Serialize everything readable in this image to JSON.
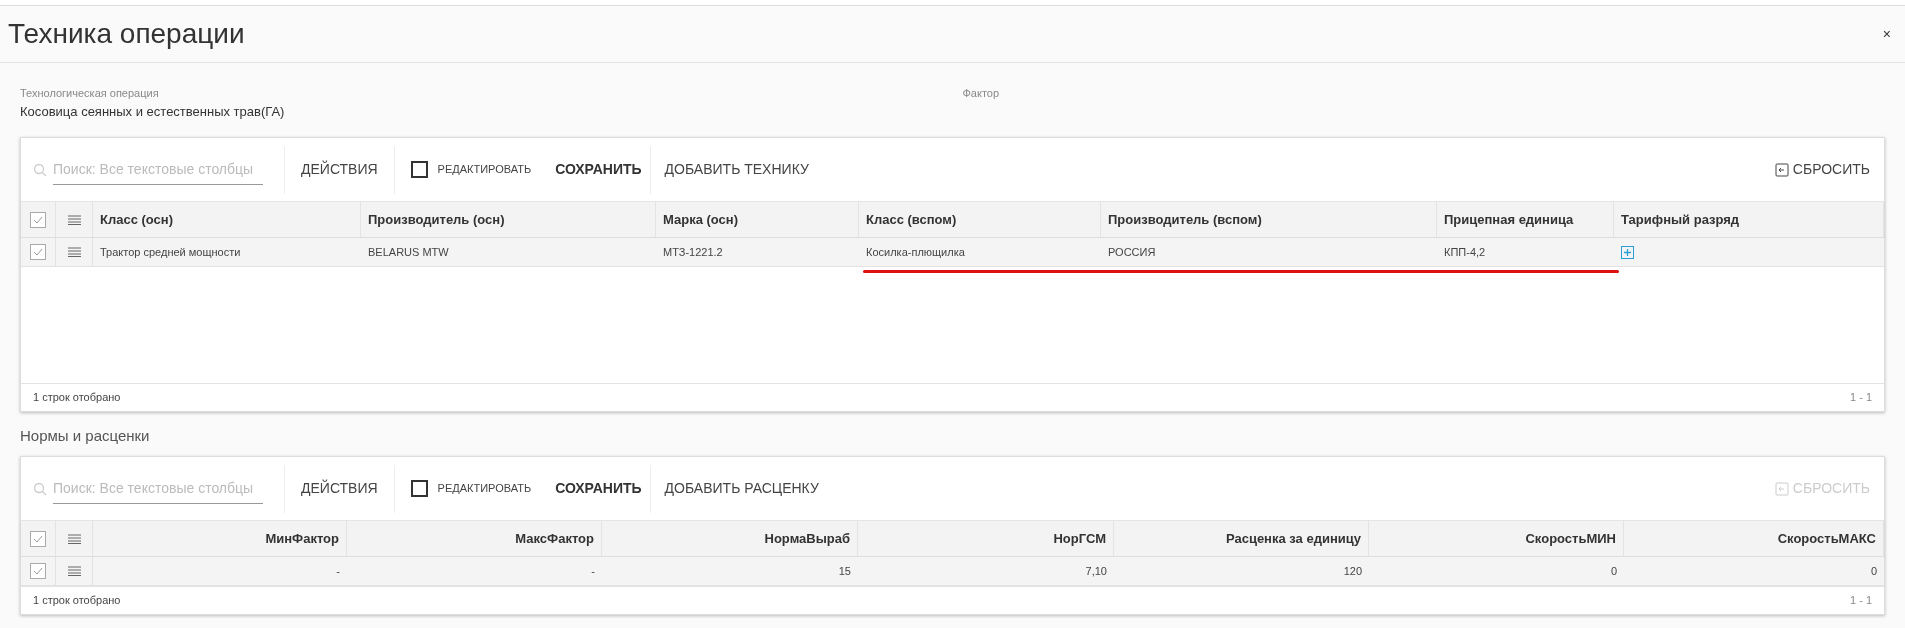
{
  "window": {
    "title": "Техника операции",
    "close": "×"
  },
  "fields": [
    {
      "label": "Технологическая операция",
      "value": "Косовица сеянных и естественных трав(ГА)"
    },
    {
      "label": "Фактор"
    }
  ],
  "grids": [
    {
      "kind": "text",
      "toolbar": {
        "search_placeholder": "Поиск: Все текстовые столбцы",
        "actions": "ДЕЙСТВИЯ",
        "edit": {
          "label": "РЕДАКТИРОВАТЬ",
          "checked": false
        },
        "save": "СОХРАНИТЬ",
        "add": "ДОБАВИТЬ ТЕХНИКУ",
        "reset": {
          "label": "СБРОСИТЬ",
          "disabled": false
        }
      },
      "header_checked": true,
      "columns": [
        "Класс (осн)",
        "Производитель (осн)",
        "Марка (осн)",
        "Класс (вспом)",
        "Производитель (вспом)",
        "Прицепная единица",
        "Тарифный разряд"
      ],
      "rows": [
        {
          "checked": true,
          "underlined": true,
          "cells": [
            {
              "kind": "text",
              "text": "Трактор средней мощности"
            },
            {
              "kind": "text",
              "text": "BELARUS MTW"
            },
            {
              "kind": "text",
              "text": "МТЗ-1221.2"
            },
            {
              "kind": "text",
              "text": "Косилка-плющилка"
            },
            {
              "kind": "text",
              "text": "РОССИЯ"
            },
            {
              "kind": "text",
              "text": "КПП-4,2"
            },
            {
              "kind": "add"
            }
          ]
        }
      ],
      "footer": {
        "count": "1 строк отобрано",
        "range": "1 - 1"
      }
    },
    {
      "kind": "numeric",
      "title": "Нормы и расценки",
      "toolbar": {
        "search_placeholder": "Поиск: Все текстовые столбцы",
        "actions": "ДЕЙСТВИЯ",
        "edit": {
          "label": "РЕДАКТИРОВАТЬ",
          "checked": false
        },
        "save": "СОХРАНИТЬ",
        "add": "ДОБАВИТЬ РАСЦЕНКУ",
        "reset": {
          "label": "СБРОСИТЬ",
          "disabled": true
        }
      },
      "header_checked": true,
      "columns": [
        "МинФактор",
        "МаксФактор",
        "НормаВыраб",
        "НорГСМ",
        "Расценка за единицу",
        "СкоростьМИН",
        "СкоростьМАКС"
      ],
      "rows": [
        {
          "checked": true,
          "underlined": false,
          "cells": [
            {
              "kind": "text",
              "text": "-"
            },
            {
              "kind": "text",
              "text": "-"
            },
            {
              "kind": "text",
              "text": "15"
            },
            {
              "kind": "text",
              "text": "7,10"
            },
            {
              "kind": "text",
              "text": "120"
            },
            {
              "kind": "text",
              "text": "0"
            },
            {
              "kind": "text",
              "text": "0"
            }
          ]
        }
      ],
      "footer": {
        "count": "1 строк отобрано",
        "range": "1 - 1"
      }
    }
  ]
}
